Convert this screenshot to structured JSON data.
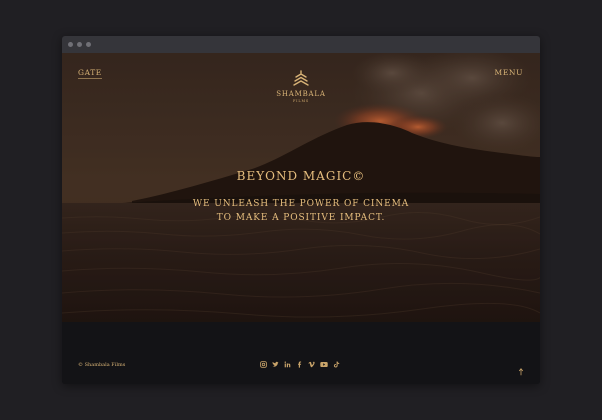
{
  "nav": {
    "gate_label": "GATE",
    "menu_label": "MENU"
  },
  "brand": {
    "name": "SHAMBALA",
    "sub": "FILMS",
    "icon": "shambala-emblem-icon"
  },
  "hero": {
    "headline": "BEYOND MAGIC©",
    "tagline_line1": "WE UNLEASH THE POWER OF CINEMA",
    "tagline_line2": "TO MAKE A POSITIVE IMPACT."
  },
  "footer": {
    "copyright": "© Shambala Films",
    "socials": [
      {
        "name": "instagram-icon",
        "glyph": "◎"
      },
      {
        "name": "twitter-icon",
        "glyph": "t"
      },
      {
        "name": "linkedin-icon",
        "glyph": "in"
      },
      {
        "name": "facebook-icon",
        "glyph": "f"
      },
      {
        "name": "vimeo-icon",
        "glyph": "v"
      },
      {
        "name": "youtube-icon",
        "glyph": "▶"
      },
      {
        "name": "tiktok-icon",
        "glyph": "♪"
      }
    ],
    "scroll_icon": "scroll-up-icon"
  },
  "colors": {
    "accent": "#d9b477",
    "page_background": "#201f23",
    "footer_background": "#131316"
  }
}
